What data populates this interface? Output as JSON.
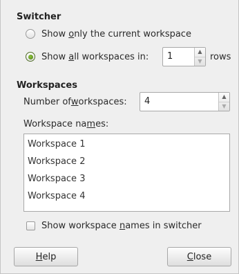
{
  "switcher": {
    "title": "Switcher",
    "option_current": {
      "pre": "Show ",
      "key": "o",
      "post": "nly the current workspace",
      "checked": false
    },
    "option_all": {
      "pre": "Show ",
      "key": "a",
      "post": "ll workspaces in:",
      "checked": true
    },
    "rows_value": "1",
    "rows_label": "rows"
  },
  "workspaces": {
    "title": "Workspaces",
    "number_label": {
      "pre": "Number of ",
      "key": "w",
      "post": "orkspaces:"
    },
    "number_value": "4",
    "names_label": {
      "pre": "Workspace na",
      "key": "m",
      "post": "es:"
    },
    "names": [
      "Workspace 1",
      "Workspace 2",
      "Workspace 3",
      "Workspace 4"
    ],
    "show_names": {
      "pre": "Show workspace ",
      "key": "n",
      "post": "ames in switcher",
      "checked": false
    }
  },
  "buttons": {
    "help": {
      "key": "H",
      "post": "elp"
    },
    "close": {
      "key": "C",
      "post": "lose"
    }
  },
  "colors": {
    "accent_radio": "#5b8f22",
    "background": "#efefef"
  }
}
